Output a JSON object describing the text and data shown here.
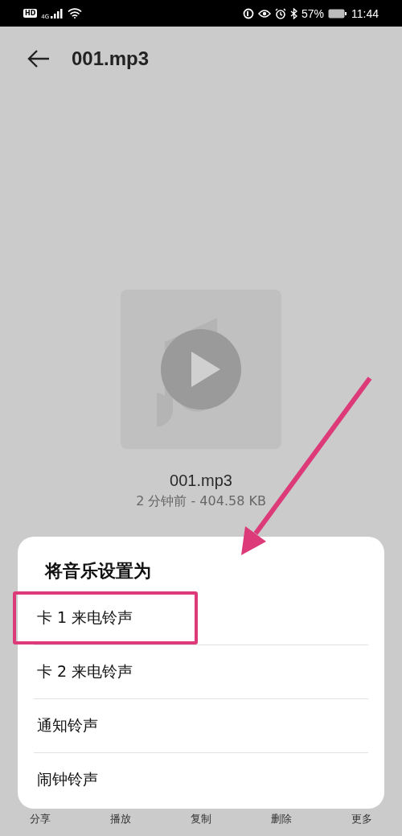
{
  "status_bar": {
    "hd": "HD",
    "network": "4G",
    "battery": "57%",
    "time": "11:44"
  },
  "header": {
    "title": "001.mp3"
  },
  "file": {
    "name": "001.mp3",
    "info": "2 分钟前 - 404.58 KB"
  },
  "toolbar": [
    "分享",
    "播放",
    "复制",
    "删除",
    "更多"
  ],
  "sheet": {
    "title": "将音乐设置为",
    "items": [
      {
        "label": "卡 1 来电铃声",
        "annotated": true
      },
      {
        "label": "卡 2 来电铃声",
        "annotated": false
      },
      {
        "label": "通知铃声",
        "annotated": false
      },
      {
        "label": "闹钟铃声",
        "annotated": false
      }
    ]
  }
}
